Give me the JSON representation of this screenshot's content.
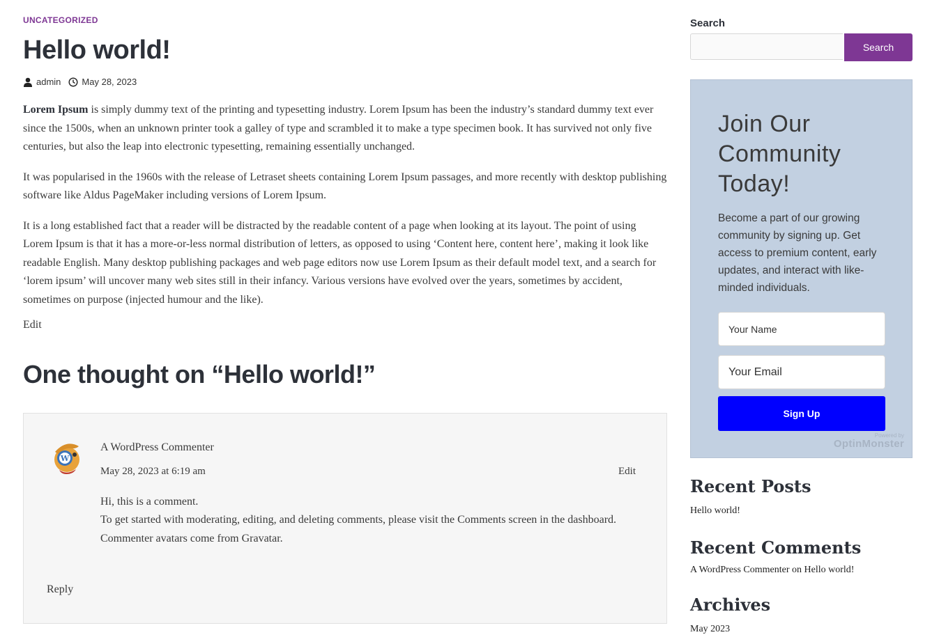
{
  "post": {
    "category": "UNCATEGORIZED",
    "title": "Hello world!",
    "author": "admin",
    "date": "May 28, 2023",
    "lead_bold": "Lorem Ipsum",
    "para1_rest": " is simply dummy text of the printing and typesetting industry. Lorem Ipsum has been the industry’s standard dummy text ever since the 1500s, when an unknown printer took a galley of type and scrambled it to make a type specimen book. It has survived not only five centuries, but also the leap into electronic typesetting, remaining essentially unchanged.",
    "para2": "It was popularised in the 1960s with the release of Letraset sheets containing Lorem Ipsum passages, and more recently with desktop publishing software like Aldus PageMaker including versions of Lorem Ipsum.",
    "para3": "It is a long established fact that a reader will be distracted by the readable content of a page when looking at its layout. The point of using Lorem Ipsum is that it has a more-or-less normal distribution of letters, as opposed to using ‘Content here, content here’, making it look like readable English. Many desktop publishing packages and web page editors now use Lorem Ipsum as their default model text, and a search for ‘lorem ipsum’ will uncover many web sites still in their infancy. Various versions have evolved over the years, sometimes by accident, sometimes on purpose (injected humour and the like).",
    "edit_label": "Edit"
  },
  "comments": {
    "title": "One thought on “Hello world!”",
    "items": [
      {
        "author": "A WordPress Commenter",
        "date": "May 28, 2023 at 6:19 am",
        "edit_label": "Edit",
        "line1": "Hi, this is a comment.",
        "line2": "To get started with moderating, editing, and deleting comments, please visit the Comments screen in the dashboard.",
        "line3": "Commenter avatars come from Gravatar.",
        "reply_label": "Reply"
      }
    ]
  },
  "sidebar": {
    "search": {
      "label": "Search",
      "placeholder": "",
      "button_label": "Search"
    },
    "optin": {
      "title": "Join Our Community Today!",
      "text": "Become a part of our growing community by signing up. Get access to premium content, early updates, and interact with like-minded individuals.",
      "name_placeholder": "Your Name",
      "email_placeholder": "Your Email",
      "button_label": "Sign Up",
      "powered_by": "Powered by",
      "logo": "OptinMonster",
      "bg_color": "#c2d0e1",
      "button_color": "#0000ff"
    },
    "recent_posts": {
      "title": "Recent Posts",
      "items": [
        "Hello world!"
      ]
    },
    "recent_comments": {
      "title": "Recent Comments",
      "author": "A WordPress Commenter",
      "on": "on",
      "post": "Hello world!"
    },
    "archives": {
      "title": "Archives",
      "items": [
        "May 2023"
      ]
    }
  },
  "colors": {
    "accent": "#7e3794",
    "heading": "#2d3139",
    "text": "#3a3a3a"
  },
  "icons": {
    "author": "user-icon",
    "date": "clock-icon"
  }
}
